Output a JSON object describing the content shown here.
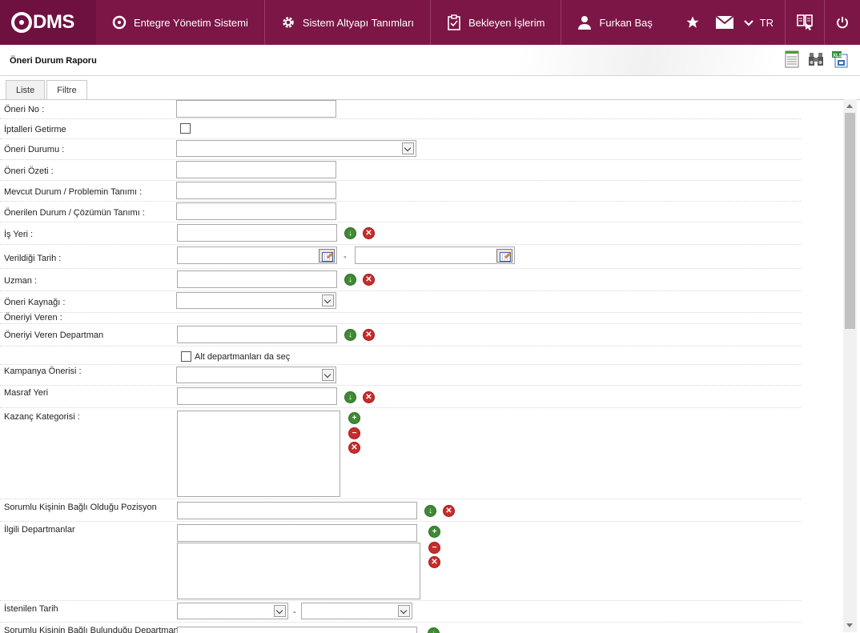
{
  "nav": {
    "logo": "DMS",
    "items": [
      {
        "label": "Entegre Yönetim Sistemi"
      },
      {
        "label": "Sistem Altyapı Tanımları"
      },
      {
        "label": "Bekleyen İşlerim"
      },
      {
        "label": "Furkan Baş"
      }
    ],
    "lang": "TR"
  },
  "page": {
    "title": "Öneri Durum Raporu",
    "tabs": [
      "Liste",
      "Filtre"
    ],
    "active_tab": "Filtre"
  },
  "form": {
    "oneri_no": "Öneri No :",
    "iptalleri_getirme": "İptalleri Getirme",
    "oneri_durumu": "Öneri Durumu :",
    "oneri_ozeti": "Öneri Özeti :",
    "mevcut_durum": "Mevcut Durum / Problemin Tanımı :",
    "onerilen_durum": "Önerilen Durum / Çözümün Tanımı :",
    "is_yeri": "İş Yeri :",
    "verildigi_tarih": "Verildiği Tarih :",
    "uzman": "Uzman :",
    "oneri_kaynagi": "Öneri Kaynağı :",
    "oneriyi_veren": "Öneriyi Veren :",
    "oneriyi_veren_departman": "Öneriyi Veren Departman",
    "alt_departmanlar": "Alt departmanları da seç",
    "kampanya_onerisi": "Kampanya Önerisi :",
    "masraf_yeri": "Masraf Yeri",
    "kazanc_kategorisi": "Kazanç Kategorisi :",
    "sorumlu_pozisyon": "Sorumlu Kişinin Bağlı Olduğu Pozisyon",
    "ilgili_departmanlar": "İlgili Departmanlar",
    "istenilen_tarih": "İstenilen Tarih",
    "sorumlu_departman": "Sorumlu Kişinin Bağlı Bulunduğu Departman",
    "date_separator": "-"
  }
}
